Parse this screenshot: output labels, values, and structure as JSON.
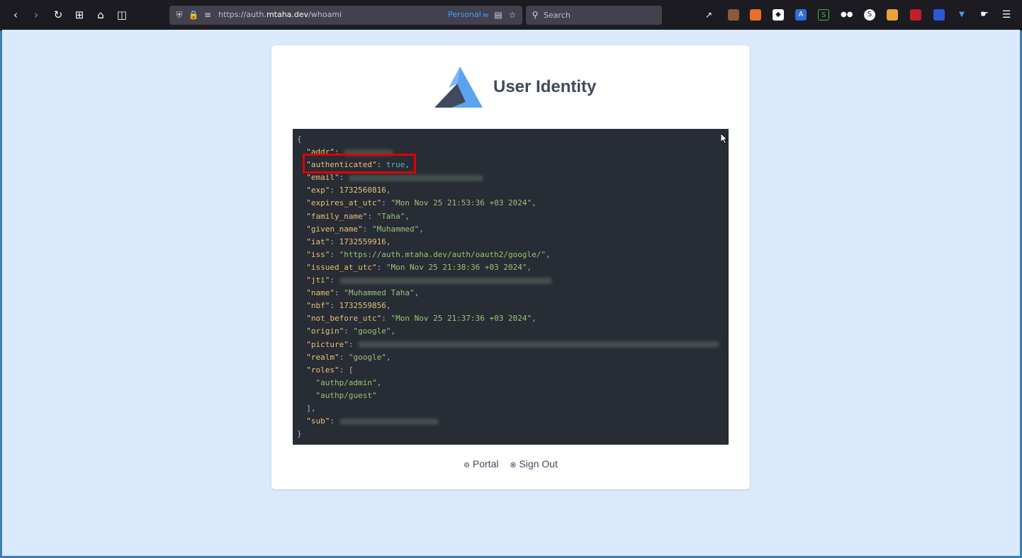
{
  "browser": {
    "url_prefix": "https://auth.",
    "url_domain": "mtaha.dev",
    "url_path": "/whoami",
    "container_label": "Personal",
    "search_placeholder": "Search"
  },
  "page": {
    "title": "User Identity",
    "json_lines": {
      "open": "{",
      "addr_key": "\"addr\"",
      "authenticated_key": "\"authenticated\"",
      "authenticated_val": "true",
      "email_key": "\"email\"",
      "exp_key": "\"exp\"",
      "exp_val": "1732560816",
      "expires_key": "\"expires_at_utc\"",
      "expires_val": "\"Mon Nov 25 21:53:36 +03 2024\"",
      "family_key": "\"family_name\"",
      "family_val": "\"Taha\"",
      "given_key": "\"given_name\"",
      "given_val": "\"Muhammed\"",
      "iat_key": "\"iat\"",
      "iat_val": "1732559916",
      "iss_key": "\"iss\"",
      "iss_val": "\"https://auth.mtaha.dev/auth/oauth2/google/\"",
      "issued_key": "\"issued_at_utc\"",
      "issued_val": "\"Mon Nov 25 21:38:36 +03 2024\"",
      "jti_key": "\"jti\"",
      "name_key": "\"name\"",
      "name_val": "\"Muhammed Taha\"",
      "nbf_key": "\"nbf\"",
      "nbf_val": "1732559856",
      "notbefore_key": "\"not_before_utc\"",
      "notbefore_val": "\"Mon Nov 25 21:37:36 +03 2024\"",
      "origin_key": "\"origin\"",
      "origin_val": "\"google\"",
      "picture_key": "\"picture\"",
      "realm_key": "\"realm\"",
      "realm_val": "\"google\"",
      "roles_key": "\"roles\"",
      "role_admin": "\"authp/admin\"",
      "role_guest": "\"authp/guest\"",
      "sub_key": "\"sub\"",
      "close": "}"
    },
    "actions": {
      "portal": "Portal",
      "signout": "Sign Out"
    }
  },
  "colors": {
    "page_bg": "#dbe9fc",
    "code_bg": "#282c34",
    "highlight": "#e00000"
  }
}
